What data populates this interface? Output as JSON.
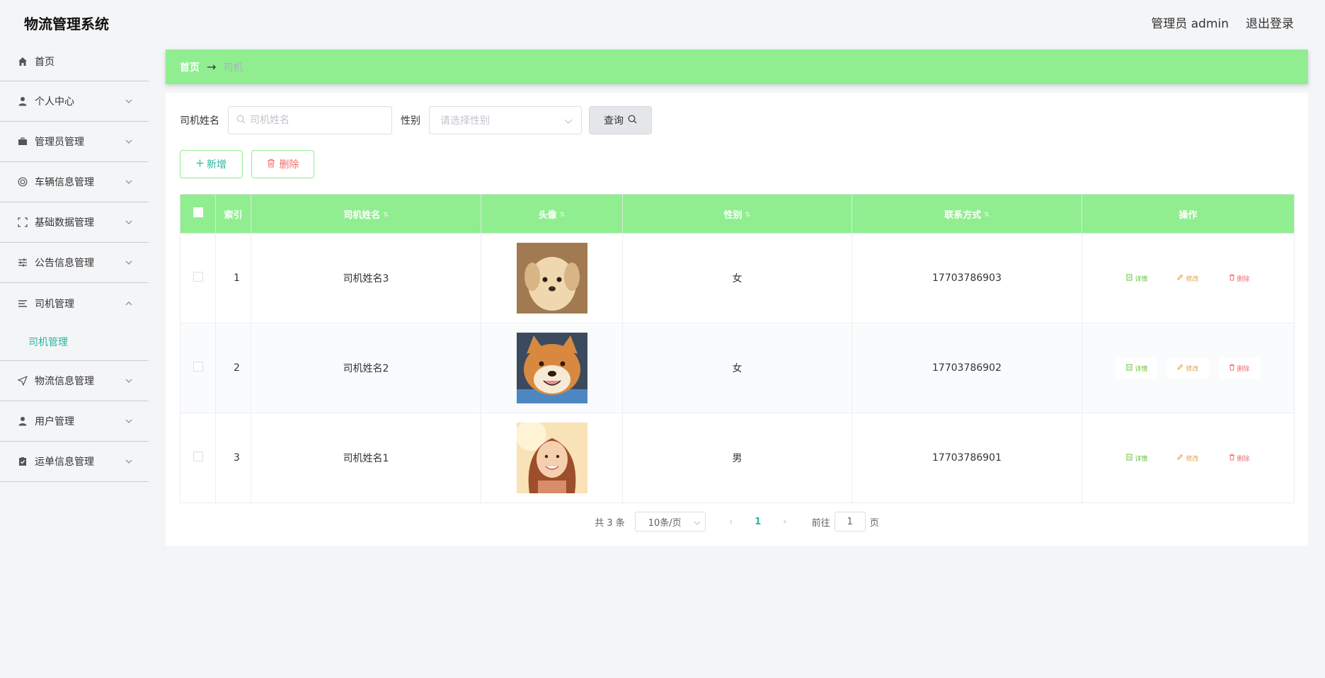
{
  "app": {
    "title": "物流管理系统"
  },
  "header": {
    "user_label": "管理员 admin",
    "logout_label": "退出登录"
  },
  "sidebar": {
    "items": [
      {
        "label": "首页",
        "icon": "home-icon"
      },
      {
        "label": "个人中心",
        "icon": "user-icon"
      },
      {
        "label": "管理员管理",
        "icon": "briefcase-icon"
      },
      {
        "label": "车辆信息管理",
        "icon": "lifebuoy-icon"
      },
      {
        "label": "基础数据管理",
        "icon": "fullscreen-icon"
      },
      {
        "label": "公告信息管理",
        "icon": "sliders-icon"
      },
      {
        "label": "司机管理",
        "icon": "menu-icon",
        "sub": "司机管理"
      },
      {
        "label": "物流信息管理",
        "icon": "send-icon"
      },
      {
        "label": "用户管理",
        "icon": "user-icon"
      },
      {
        "label": "运单信息管理",
        "icon": "clipboard-check-icon"
      }
    ]
  },
  "breadcrumb": {
    "home": "首页",
    "current": "司机"
  },
  "search": {
    "name_label": "司机姓名",
    "name_placeholder": "司机姓名",
    "gender_label": "性别",
    "gender_placeholder": "请选择性别",
    "query_label": "查询"
  },
  "actions": {
    "add_label": "新增",
    "delete_label": "删除"
  },
  "table": {
    "headers": [
      "索引",
      "司机姓名",
      "头像",
      "性别",
      "联系方式",
      "操作"
    ],
    "rows": [
      {
        "index": "1",
        "name": "司机姓名3",
        "avatar": "puppy-photo",
        "gender": "女",
        "phone": "17703786903"
      },
      {
        "index": "2",
        "name": "司机姓名2",
        "avatar": "shiba-photo",
        "gender": "女",
        "phone": "17703786902"
      },
      {
        "index": "3",
        "name": "司机姓名1",
        "avatar": "woman-photo",
        "gender": "男",
        "phone": "17703786901"
      }
    ],
    "ops": {
      "detail": "详情",
      "edit": "修改",
      "remove": "删除"
    }
  },
  "pagination": {
    "total": "共 3 条",
    "page_size": "10条/页",
    "current": "1",
    "goto_label": "前往",
    "goto_value": "1",
    "page_suffix": "页"
  },
  "colors": {
    "accent": "#90ee90",
    "teal": "#2ab5a0",
    "danger": "#f56c6c",
    "warning": "#e6a23c",
    "success": "#67c23a"
  }
}
